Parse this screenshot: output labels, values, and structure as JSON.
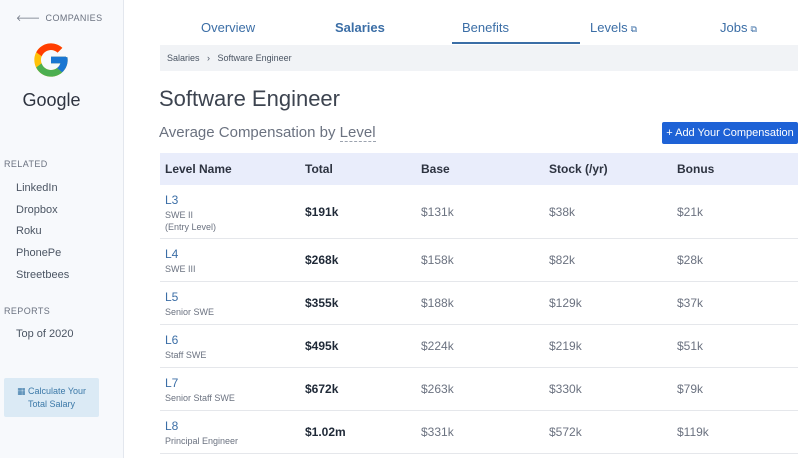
{
  "sidebar": {
    "back_label": "COMPANIES",
    "company_name": "Google",
    "related_heading": "RELATED",
    "related": [
      "LinkedIn",
      "Dropbox",
      "Roku",
      "PhonePe",
      "Streetbees"
    ],
    "reports_heading": "REPORTS",
    "reports": [
      "Top of 2020"
    ],
    "calc_line1": "Calculate Your",
    "calc_line2": "Total Salary"
  },
  "tabs": {
    "overview": "Overview",
    "salaries": "Salaries",
    "benefits": "Benefits",
    "levels": "Levels",
    "jobs": "Jobs"
  },
  "breadcrumb": {
    "root": "Salaries",
    "sep": "›",
    "current": "Software Engineer"
  },
  "page": {
    "title": "Software Engineer",
    "subtitle_prefix": "Average Compensation by ",
    "subtitle_level": "Level",
    "add_button": "+ Add Your Compensation"
  },
  "table": {
    "headers": {
      "level": "Level Name",
      "total": "Total",
      "base": "Base",
      "stock": "Stock (/yr)",
      "bonus": "Bonus"
    },
    "rows": [
      {
        "level": "L3",
        "desc1": "SWE II",
        "desc2": "(Entry Level)",
        "total": "$191k",
        "base": "$131k",
        "stock": "$38k",
        "bonus": "$21k"
      },
      {
        "level": "L4",
        "desc1": "SWE III",
        "desc2": "",
        "total": "$268k",
        "base": "$158k",
        "stock": "$82k",
        "bonus": "$28k"
      },
      {
        "level": "L5",
        "desc1": "Senior SWE",
        "desc2": "",
        "total": "$355k",
        "base": "$188k",
        "stock": "$129k",
        "bonus": "$37k"
      },
      {
        "level": "L6",
        "desc1": "Staff SWE",
        "desc2": "",
        "total": "$495k",
        "base": "$224k",
        "stock": "$219k",
        "bonus": "$51k"
      },
      {
        "level": "L7",
        "desc1": "Senior Staff SWE",
        "desc2": "",
        "total": "$672k",
        "base": "$263k",
        "stock": "$330k",
        "bonus": "$79k"
      },
      {
        "level": "L8",
        "desc1": "Principal Engineer",
        "desc2": "",
        "total": "$1.02m",
        "base": "$331k",
        "stock": "$572k",
        "bonus": "$119k"
      }
    ]
  },
  "colors": {
    "accent": "#3b6ea6",
    "button": "#1e62d6",
    "header_bg": "#e9edfb"
  }
}
